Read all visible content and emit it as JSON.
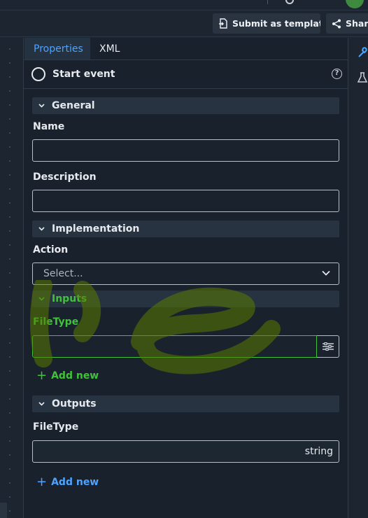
{
  "toolbar": {
    "submit_template_label": "Submit as template",
    "share_label": "Share"
  },
  "tabs": [
    {
      "label": "Properties",
      "active": true
    },
    {
      "label": "XML",
      "active": false
    }
  ],
  "element": {
    "title": "Start event",
    "help_icon": "?"
  },
  "sections": {
    "general": "General",
    "implementation": "Implementation",
    "inputs": "Inputs",
    "outputs": "Outputs"
  },
  "fields": {
    "name_label": "Name",
    "name_value": "",
    "description_label": "Description",
    "description_value": "",
    "action_label": "Action",
    "action_placeholder": "Select...",
    "input_filetype_label": "FileType",
    "input_filetype_value": "",
    "output_filetype_label": "FileType",
    "output_filetype_type": "string"
  },
  "actions": {
    "add_new_input": "Add new",
    "add_new_output": "Add new"
  },
  "colors": {
    "accent_blue": "#4da3ff",
    "accent_green": "#41c23a",
    "panel_bg": "#19222c"
  }
}
